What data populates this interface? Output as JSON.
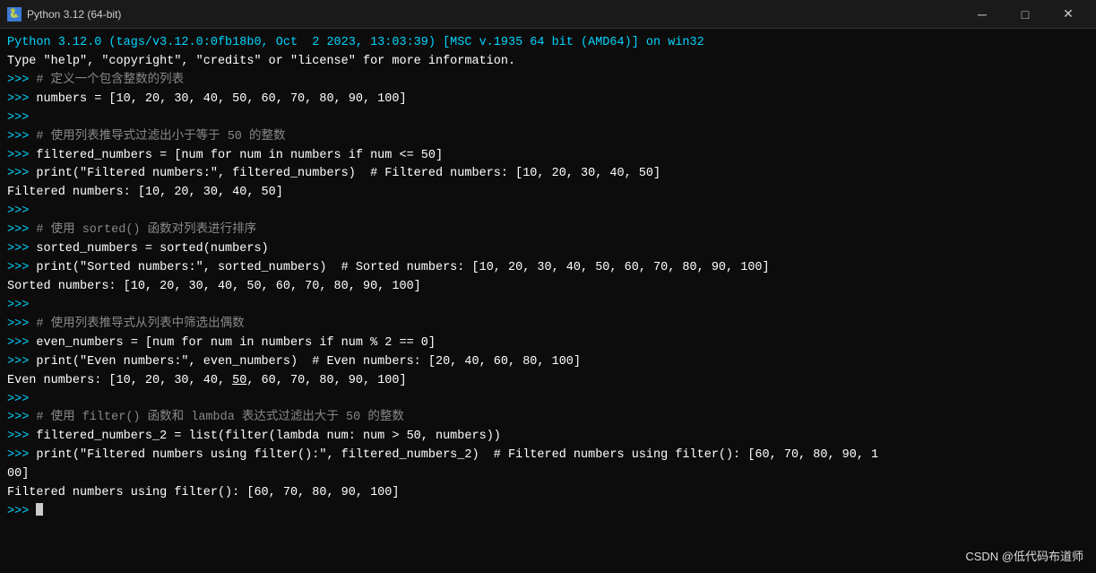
{
  "titleBar": {
    "icon": "🐍",
    "title": "Python 3.12 (64-bit)",
    "minLabel": "─",
    "maxLabel": "□",
    "closeLabel": "✕"
  },
  "terminal": {
    "lines": [
      {
        "type": "header",
        "text": "Python 3.12.0 (tags/v3.12.0:0fb18b0, Oct  2 2023, 13:03:39) [MSC v.1935 64 bit (AMD64)] on win32"
      },
      {
        "type": "header",
        "text": "Type \"help\", \"copyright\", \"credits\" or \"license\" for more information."
      },
      {
        "type": "prompt_comment",
        "prompt": ">>> ",
        "text": "# 定义一个包含整数的列表"
      },
      {
        "type": "prompt_code",
        "prompt": ">>> ",
        "text": "numbers = [10, 20, 30, 40, 50, 60, 70, 80, 90, 100]"
      },
      {
        "type": "prompt_empty",
        "prompt": ">>> ",
        "text": ""
      },
      {
        "type": "prompt_comment",
        "prompt": ">>> ",
        "text": "# 使用列表推导式过滤出小于等于 50 的整数"
      },
      {
        "type": "prompt_code",
        "prompt": ">>> ",
        "text": "filtered_numbers = [num for num in numbers if num <= 50]"
      },
      {
        "type": "prompt_code",
        "prompt": ">>> ",
        "text": "print(\"Filtered numbers:\", filtered_numbers)  # Filtered numbers: [10, 20, 30, 40, 50]"
      },
      {
        "type": "output",
        "text": "Filtered numbers: [10, 20, 30, 40, 50]"
      },
      {
        "type": "prompt_empty",
        "prompt": ">>> ",
        "text": ""
      },
      {
        "type": "prompt_comment",
        "prompt": ">>> ",
        "text": "# 使用 sorted() 函数对列表进行排序"
      },
      {
        "type": "prompt_code",
        "prompt": ">>> ",
        "text": "sorted_numbers = sorted(numbers)"
      },
      {
        "type": "prompt_code",
        "prompt": ">>> ",
        "text": "print(\"Sorted numbers:\", sorted_numbers)  # Sorted numbers: [10, 20, 30, 40, 50, 60, 70, 80, 90, 100]"
      },
      {
        "type": "output",
        "text": "Sorted numbers: [10, 20, 30, 40, 50, 60, 70, 80, 90, 100]"
      },
      {
        "type": "prompt_empty",
        "prompt": ">>> ",
        "text": ""
      },
      {
        "type": "prompt_comment",
        "prompt": ">>> ",
        "text": "# 使用列表推导式从列表中筛选出偶数"
      },
      {
        "type": "prompt_code",
        "prompt": ">>> ",
        "text": "even_numbers = [num for num in numbers if num % 2 == 0]"
      },
      {
        "type": "prompt_code",
        "prompt": ">>> ",
        "text": "print(\"Even numbers:\", even_numbers)  # Even numbers: [20, 40, 60, 80, 100]"
      },
      {
        "type": "output",
        "text": "Even numbers: [10, 20, 30, 40, 50, 60, 70, 80, 90, 100]"
      },
      {
        "type": "prompt_empty",
        "prompt": ">>> ",
        "text": ""
      },
      {
        "type": "prompt_comment",
        "prompt": ">>> ",
        "text": "# 使用 filter() 函数和 lambda 表达式过滤出大于 50 的整数"
      },
      {
        "type": "prompt_code",
        "prompt": ">>> ",
        "text": "filtered_numbers_2 = list(filter(lambda num: num > 50, numbers))"
      },
      {
        "type": "prompt_code_wrap",
        "prompt": ">>> ",
        "text": "print(\"Filtered numbers using filter():\", filtered_numbers_2)  # Filtered numbers using filter(): [60, 70, 80, 90, 1"
      },
      {
        "type": "output_wrap",
        "text": "00]"
      },
      {
        "type": "output",
        "text": "Filtered numbers using filter(): [60, 70, 80, 90, 100]"
      },
      {
        "type": "prompt_cursor",
        "prompt": ">>> ",
        "text": ""
      }
    ]
  },
  "watermark": {
    "text": "CSDN @低代码布道师"
  }
}
